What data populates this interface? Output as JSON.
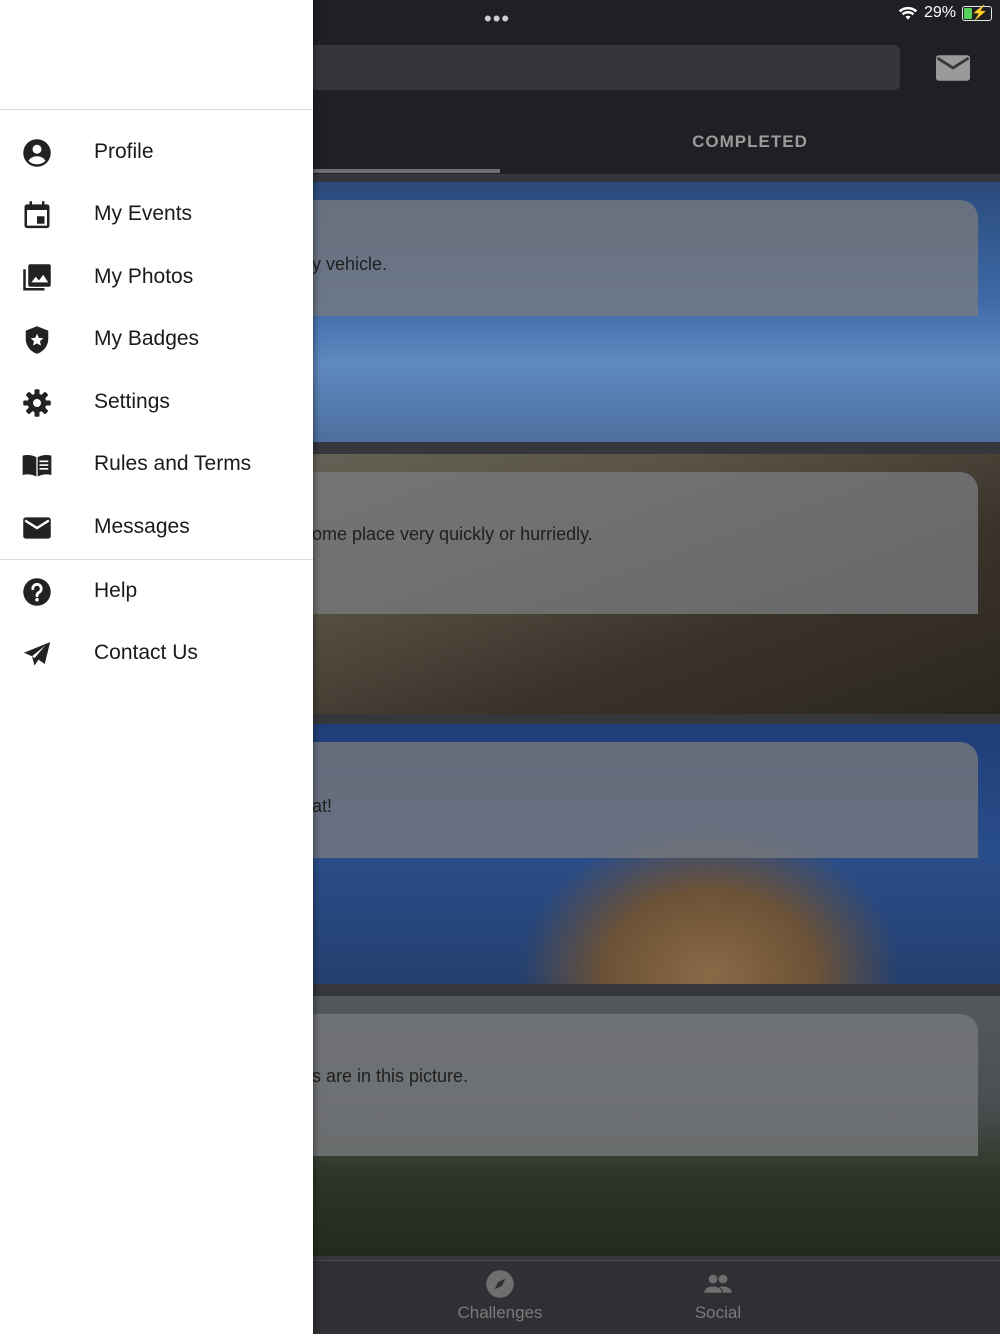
{
  "status_bar": {
    "more_dots": "•••",
    "battery_percent": "29%",
    "battery_level": 0.29
  },
  "tabs": [
    {
      "label": ""
    },
    {
      "label": "COMPLETED"
    }
  ],
  "challenges": [
    {
      "text": "y vehicle."
    },
    {
      "text": "ome place very quickly or hurriedly."
    },
    {
      "text": "at!"
    },
    {
      "text": "s are in this picture."
    }
  ],
  "bottom_nav": [
    {
      "label": "Challenges",
      "icon": "compass-icon"
    },
    {
      "label": "Social",
      "icon": "people-icon"
    }
  ],
  "drawer": {
    "items": [
      {
        "label": "Profile",
        "icon": "account-circle-icon"
      },
      {
        "label": "My Events",
        "icon": "calendar-icon"
      },
      {
        "label": "My Photos",
        "icon": "photo-library-icon"
      },
      {
        "label": "My Badges",
        "icon": "shield-star-icon"
      },
      {
        "label": "Settings",
        "icon": "gear-icon"
      },
      {
        "label": "Rules and Terms",
        "icon": "book-icon"
      },
      {
        "label": "Messages",
        "icon": "mail-icon"
      }
    ],
    "secondary_items": [
      {
        "label": "Help",
        "icon": "help-circle-icon"
      },
      {
        "label": "Contact Us",
        "icon": "send-icon"
      }
    ]
  }
}
